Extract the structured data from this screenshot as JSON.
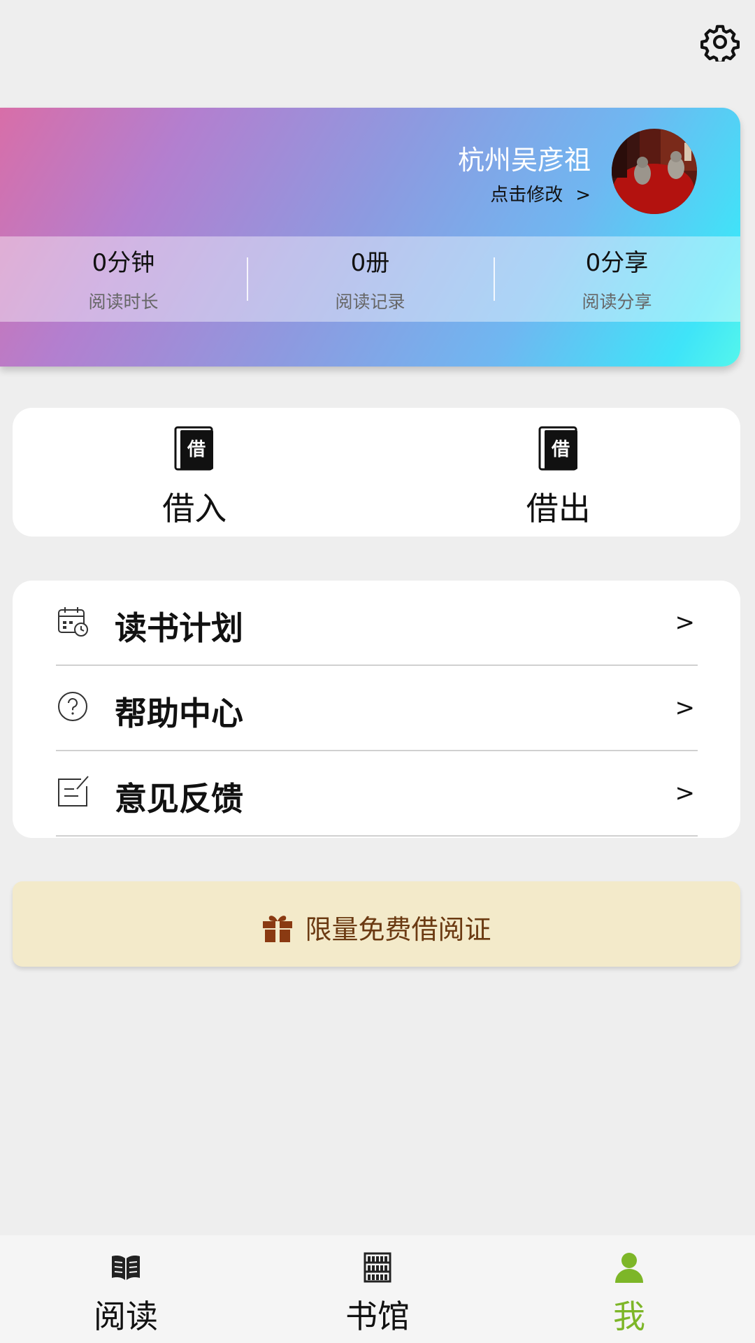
{
  "profile": {
    "name": "杭州吴彦祖",
    "edit_label": "点击修改",
    "edit_chevron": ">",
    "stats": [
      {
        "value": "0分钟",
        "label": "阅读时长"
      },
      {
        "value": "0册",
        "label": "阅读记录"
      },
      {
        "value": "0分享",
        "label": "阅读分享"
      }
    ]
  },
  "borrow": {
    "items": [
      {
        "label": "借入",
        "icon_glyph": "借",
        "icon": "borrow-book-icon"
      },
      {
        "label": "借出",
        "icon_glyph": "借",
        "icon": "lend-book-icon"
      }
    ]
  },
  "menu": {
    "chevron": ">",
    "items": [
      {
        "label": "读书计划",
        "icon": "calendar-clock-icon"
      },
      {
        "label": "帮助中心",
        "icon": "question-circle-icon"
      },
      {
        "label": "意见反馈",
        "icon": "edit-note-icon"
      }
    ]
  },
  "promo": {
    "text": "限量免费借阅证",
    "icon": "gift-icon"
  },
  "tabbar": {
    "active_color": "#7db628",
    "items": [
      {
        "label": "阅读",
        "icon": "open-book-icon"
      },
      {
        "label": "书馆",
        "icon": "bookshelf-icon"
      },
      {
        "label": "我",
        "icon": "person-icon",
        "active": true
      }
    ]
  },
  "icons": {
    "settings": "gear-icon"
  }
}
